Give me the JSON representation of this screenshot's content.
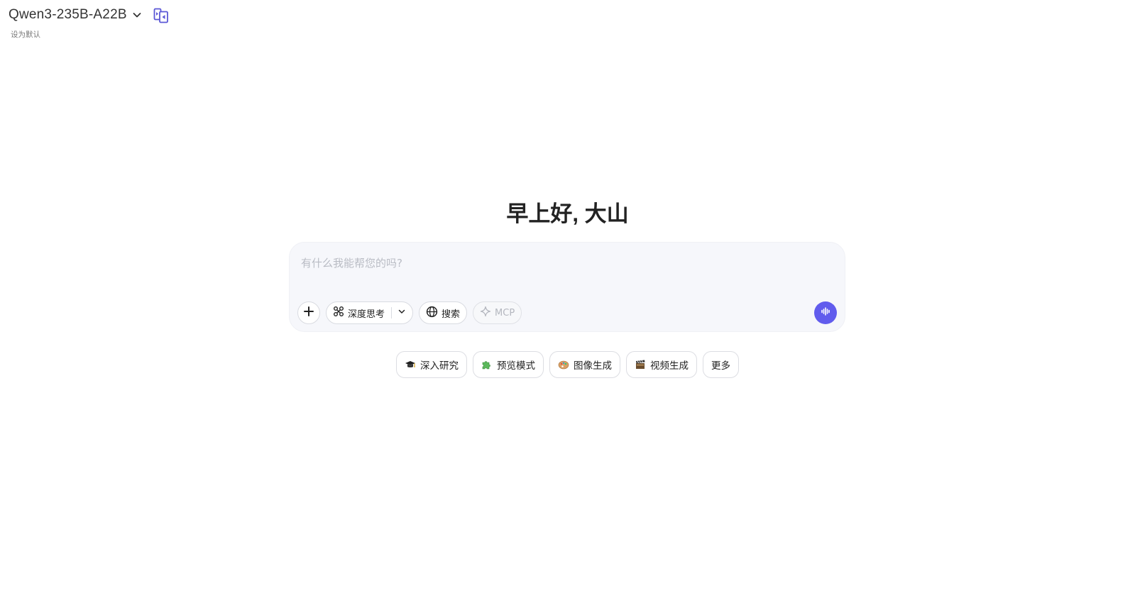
{
  "header": {
    "model_name": "Qwen3-235B-A22B",
    "set_default_label": "设为默认"
  },
  "greeting": "早上好, 大山",
  "composer": {
    "placeholder": "有什么我能帮您的吗?",
    "value": "",
    "tools": {
      "deep_think_label": "深度思考",
      "search_label": "搜索",
      "mcp_label": "MCP"
    }
  },
  "quick_actions": [
    {
      "label": "深入研究",
      "icon": "graduation-cap-icon"
    },
    {
      "label": "预览模式",
      "icon": "puzzle-icon"
    },
    {
      "label": "图像生成",
      "icon": "palette-icon"
    },
    {
      "label": "视频生成",
      "icon": "film-icon"
    },
    {
      "label": "更多",
      "icon": ""
    }
  ],
  "colors": {
    "accent": "#615ced",
    "composer_bg": "#f6f7fb",
    "compare_icon": "#5b57d6"
  }
}
